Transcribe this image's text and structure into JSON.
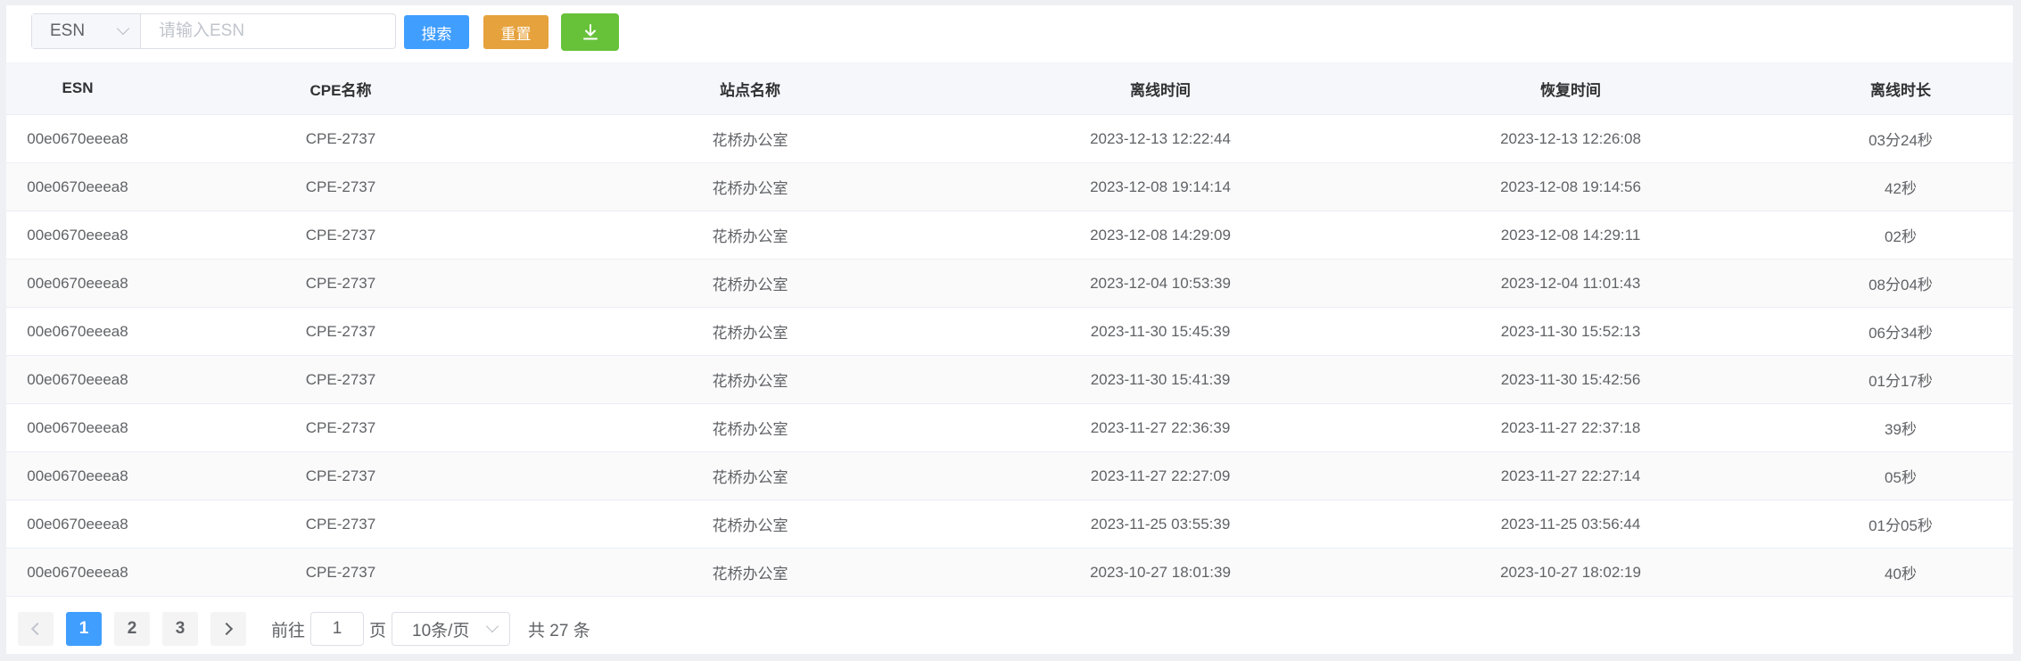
{
  "toolbar": {
    "search_field_selected": "ESN",
    "search_placeholder": "请输入ESN",
    "search_value": "",
    "search_button": "搜索",
    "reset_button": "重置",
    "download_icon": "download-icon"
  },
  "table": {
    "headers": [
      "ESN",
      "CPE名称",
      "站点名称",
      "离线时间",
      "恢复时间",
      "离线时长"
    ],
    "rows": [
      [
        "00e0670eeea8",
        "CPE-2737",
        "花桥办公室",
        "2023-12-13 12:22:44",
        "2023-12-13 12:26:08",
        "03分24秒"
      ],
      [
        "00e0670eeea8",
        "CPE-2737",
        "花桥办公室",
        "2023-12-08 19:14:14",
        "2023-12-08 19:14:56",
        "42秒"
      ],
      [
        "00e0670eeea8",
        "CPE-2737",
        "花桥办公室",
        "2023-12-08 14:29:09",
        "2023-12-08 14:29:11",
        "02秒"
      ],
      [
        "00e0670eeea8",
        "CPE-2737",
        "花桥办公室",
        "2023-12-04 10:53:39",
        "2023-12-04 11:01:43",
        "08分04秒"
      ],
      [
        "00e0670eeea8",
        "CPE-2737",
        "花桥办公室",
        "2023-11-30 15:45:39",
        "2023-11-30 15:52:13",
        "06分34秒"
      ],
      [
        "00e0670eeea8",
        "CPE-2737",
        "花桥办公室",
        "2023-11-30 15:41:39",
        "2023-11-30 15:42:56",
        "01分17秒"
      ],
      [
        "00e0670eeea8",
        "CPE-2737",
        "花桥办公室",
        "2023-11-27 22:36:39",
        "2023-11-27 22:37:18",
        "39秒"
      ],
      [
        "00e0670eeea8",
        "CPE-2737",
        "花桥办公室",
        "2023-11-27 22:27:09",
        "2023-11-27 22:27:14",
        "05秒"
      ],
      [
        "00e0670eeea8",
        "CPE-2737",
        "花桥办公室",
        "2023-11-25 03:55:39",
        "2023-11-25 03:56:44",
        "01分05秒"
      ],
      [
        "00e0670eeea8",
        "CPE-2737",
        "花桥办公室",
        "2023-10-27 18:01:39",
        "2023-10-27 18:02:19",
        "40秒"
      ]
    ]
  },
  "pagination": {
    "pages": [
      "1",
      "2",
      "3"
    ],
    "current_page": "1",
    "goto_prefix": "前往",
    "goto_value": "1",
    "goto_suffix": "页",
    "page_size": "10条/页",
    "total": "共 27 条"
  },
  "colors": {
    "primary": "#409eff",
    "warning": "#e6a23c",
    "success": "#67c23a"
  }
}
